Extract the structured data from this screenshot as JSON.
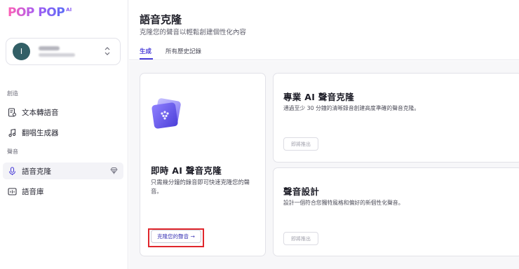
{
  "brand": {
    "word": "POP POP",
    "suffix": "AI"
  },
  "account": {
    "initial": "I"
  },
  "sidebar": {
    "sections": [
      {
        "label": "創造",
        "items": [
          {
            "label": "文本轉語音",
            "icon": "document-audio-icon"
          },
          {
            "label": "翻唱生成器",
            "icon": "music-note-icon"
          }
        ]
      },
      {
        "label": "聲音",
        "items": [
          {
            "label": "語音克隆",
            "icon": "microphone-icon",
            "active": true,
            "badge": "diamond-icon"
          },
          {
            "label": "語音庫",
            "icon": "voice-library-icon"
          }
        ]
      }
    ]
  },
  "header": {
    "title": "語音克隆",
    "subtitle": "克隆您的聲音以輕鬆創建個性化內容",
    "tabs": [
      {
        "label": "生成",
        "active": true
      },
      {
        "label": "所有歷史記錄"
      }
    ]
  },
  "cards": {
    "instant": {
      "title": "即時 AI 聲音克隆",
      "desc": "只需幾分鐘的錄音即可快速克隆您的聲音。",
      "button": "克隆您的聲音 →"
    },
    "pro": {
      "title": "專業 AI 聲音克隆",
      "desc": "通過至少 30 分鐘的清晰錄音創建高度準確的聲音克隆。",
      "button": "即將推出"
    },
    "design": {
      "title": "聲音設計",
      "desc": "設計一個符合您獨特風格和偏好的新個性化聲音。",
      "button": "即將推出"
    }
  },
  "colors": {
    "accent": "#4b3fd8",
    "highlight": "#e0262c",
    "brand_gradient": [
      "#ff5fb3",
      "#a65cf3",
      "#5b6cf6"
    ]
  }
}
